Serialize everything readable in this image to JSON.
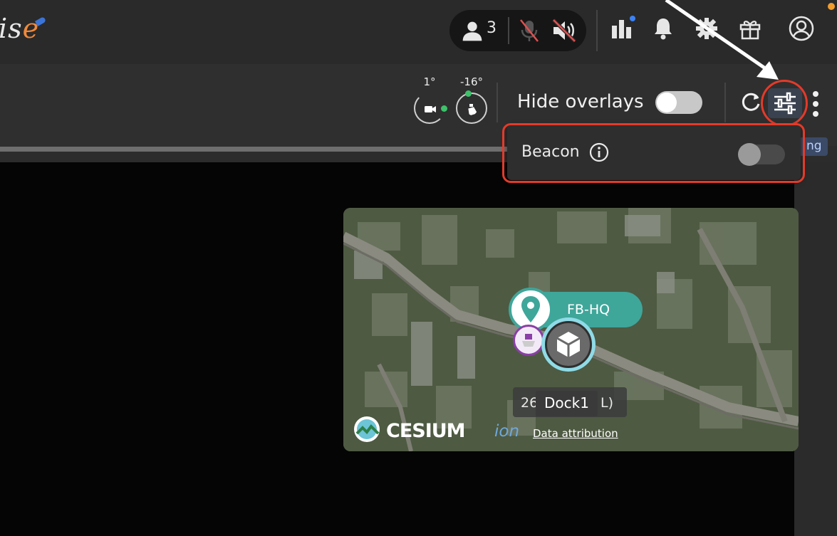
{
  "header": {
    "logo_text": "is",
    "logo_e": "e",
    "participants_count": "3",
    "icons": [
      "user-icon",
      "mic-off-icon",
      "speaker-off-icon",
      "analytics-icon",
      "bell-icon",
      "gear-icon",
      "gift-icon",
      "account-icon"
    ],
    "colors": {
      "notification_dot": "#3b82f6",
      "account_dot": "#f39c2c"
    }
  },
  "toolbar": {
    "camera_angle": "1°",
    "gimbal_angle": "-16°",
    "hide_overlays_label": "Hide overlays",
    "hide_overlays_on": true,
    "badge_partial": "ng"
  },
  "dropdown": {
    "beacon_label": "Beacon",
    "beacon_on": false
  },
  "map": {
    "site_label": "FB-HQ",
    "dock_number_partial": "26",
    "dock_label": "Dock1",
    "dock_suffix": "L)",
    "provider_text": "CESIUM",
    "provider_suffix": "ion",
    "attribution_link": "Data attribution",
    "colors": {
      "site_teal": "#3fa69a",
      "highlight_red": "#e43a2a"
    }
  }
}
